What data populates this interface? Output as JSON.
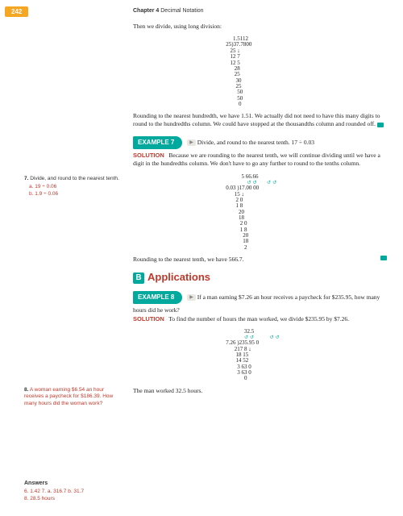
{
  "page_number": "242",
  "chapter": {
    "label": "Chapter 4",
    "title": "Decimal Notation"
  },
  "intro_text": "Then we divide, using long division:",
  "longdiv1": "        1.5112\n   25)37.7800\n      25 ↓\n      12 7\n      12 5\n         28\n         25\n          30\n          25\n           50\n           50\n            0",
  "rounding_note": "Rounding to the nearest hundredth, we have 1.51. We actually did not need to have this many digits to round to the hundredths column. We could have stopped at the thousandths column and rounded off.",
  "ex7_label": "EXAMPLE 7",
  "ex7_problem": "Divide, and round to the nearest tenth. 17 ÷ 0.03",
  "ex7_solution": "Because we are rounding to the nearest tenth, we will continue dividing until we have a digit in the hundredths column. We don't have to go any further to round to the tenths column.",
  "longdiv2_top": "              5 66.66",
  "longdiv2": "   0.03 )17.00 00\n         15 ↓\n          2 0\n          1 8\n            20\n            18\n             2 0\n             1 8\n               20\n               18\n                2",
  "ex7_conclude": "Rounding to the nearest tenth, we have 566.7.",
  "apps_title": "Applications",
  "ex8_label": "EXAMPLE 8",
  "ex8_problem": "If a man earning $7.26 an hour receives a paycheck for $235.95, how many hours did he work?",
  "ex8_solution": "To find the number of hours the man worked, we divide $235.95 by $7.26.",
  "longdiv3_top": "                32.5",
  "longdiv3": "   7.26 )235.95 0\n         217 8 ↓\n          18 15\n          14 52\n           3 63 0\n           3 63 0\n                0",
  "ex8_conclude": "The man worked 32.5 hours.",
  "sidebar": {
    "q7": "Divide, and round to the nearest tenth.",
    "q7_num": "7.",
    "q7a": "a.  19 ÷ 0.06",
    "q7b": "b.  1.9 ÷ 0.06",
    "q8_num": "8.",
    "q8": "A woman earning $6.54 an hour receives a paycheck for $186.39. How many hours did the woman work?",
    "answers_label": "Answers",
    "answers_line1": "6.  1.42   7.  a.  316.7    b.  31.7",
    "answers_line2": "8.  28.5 hours"
  }
}
